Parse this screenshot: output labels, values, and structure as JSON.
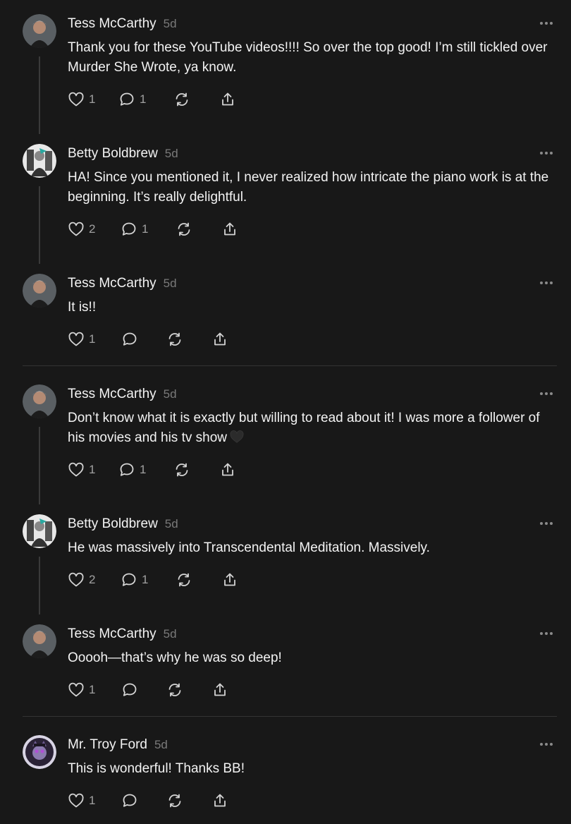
{
  "posts": [
    {
      "author": "Tess McCarthy",
      "time": "5d",
      "text": "Thank you for these YouTube videos!!!! So over the top good! I’m still tickled over Murder She Wrote, ya know.",
      "likes": "1",
      "replies": "1",
      "avatar": "tess-avatar"
    },
    {
      "author": "Betty Boldbrew",
      "time": "5d",
      "text": "HA! Since you mentioned it, I never realized how intricate the piano work is at the beginning. It’s really delightful.",
      "likes": "2",
      "replies": "1",
      "avatar": "betty-avatar"
    },
    {
      "author": "Tess McCarthy",
      "time": "5d",
      "text": "It is!!",
      "likes": "1",
      "replies": "",
      "avatar": "tess-avatar"
    },
    {
      "author": "Tess McCarthy",
      "time": "5d",
      "text": "Don’t know what it is exactly but willing to read about it! I was more a follower of his movies and his tv show",
      "likes": "1",
      "replies": "1",
      "avatar": "tess-avatar",
      "emoji": "black-heart-icon"
    },
    {
      "author": "Betty Boldbrew",
      "time": "5d",
      "text": "He was massively into Transcendental Meditation. Massively.",
      "likes": "2",
      "replies": "1",
      "avatar": "betty-avatar"
    },
    {
      "author": "Tess McCarthy",
      "time": "5d",
      "text": "Ooooh—that’s why he was so deep!",
      "likes": "1",
      "replies": "",
      "avatar": "tess-avatar"
    },
    {
      "author": "Mr. Troy Ford",
      "time": "5d",
      "text": "This is wonderful! Thanks BB!",
      "likes": "1",
      "replies": "",
      "avatar": "troy-avatar"
    }
  ],
  "colors": {
    "background": "#181818",
    "text": "#f3f3f3",
    "muted": "#7a7a7a",
    "thread_line": "#3a3a3a"
  }
}
